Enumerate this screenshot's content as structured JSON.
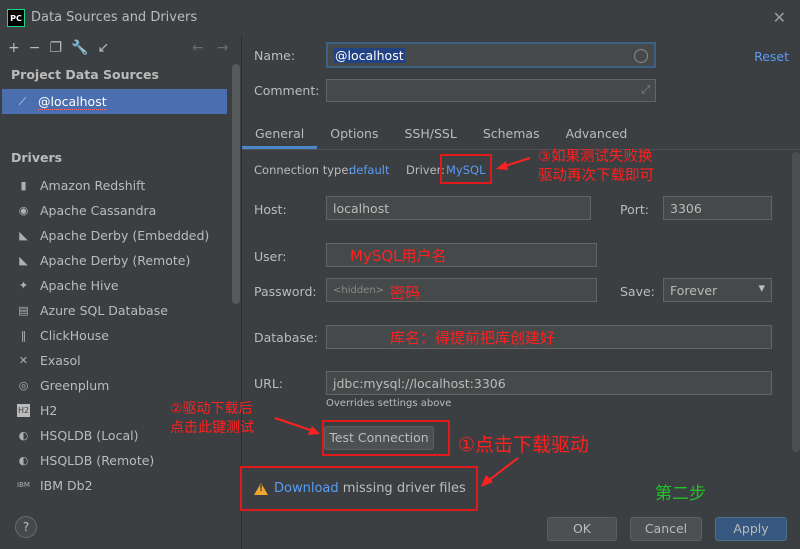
{
  "window": {
    "title": "Data Sources and Drivers",
    "app_badge": "PC",
    "close_glyph": "✕"
  },
  "toolbar": {
    "icons": [
      "add-icon",
      "remove-icon",
      "duplicate-icon",
      "wrench-icon",
      "import-icon",
      "back-arrow-icon",
      "forward-arrow-icon"
    ]
  },
  "left": {
    "project_title": "Project Data Sources",
    "selected": "@localhost",
    "drivers_title": "Drivers",
    "drivers": [
      "Amazon Redshift",
      "Apache Cassandra",
      "Apache Derby (Embedded)",
      "Apache Derby (Remote)",
      "Apache Hive",
      "Azure SQL Database",
      "ClickHouse",
      "Exasol",
      "Greenplum",
      "H2",
      "HSQLDB (Local)",
      "HSQLDB (Remote)",
      "IBM Db2"
    ]
  },
  "form": {
    "name_label": "Name:",
    "name_value": "@localhost",
    "comment_label": "Comment:",
    "reset_label": "Reset",
    "tabs": [
      "General",
      "Options",
      "SSH/SSL",
      "Schemas",
      "Advanced"
    ],
    "conn_type_label": "Connection type:",
    "conn_type_value": "default",
    "driver_label": "Driver:",
    "driver_value": "MySQL",
    "host_label": "Host:",
    "host_value": "localhost",
    "port_label": "Port:",
    "port_value": "3306",
    "user_label": "User:",
    "password_label": "Password:",
    "password_placeholder": "<hidden>",
    "save_label": "Save:",
    "save_value": "Forever",
    "database_label": "Database:",
    "url_label": "URL:",
    "url_value": "jdbc:mysql://localhost:3306",
    "overrides_hint": "Overrides settings above",
    "test_button": "Test Connection"
  },
  "warning": {
    "link": "Download",
    "text": " missing driver files"
  },
  "footer": {
    "help": "?",
    "ok": "OK",
    "cancel": "Cancel",
    "apply": "Apply"
  },
  "annotations": {
    "step3_line1": "③如果测试失败换",
    "step3_line2": "驱动再次下载即可",
    "user_note": "MySQL用户名",
    "password_note": "密码",
    "database_note": "库名：得提前把库创建好",
    "step2_line1": "②驱动下载后",
    "step2_line2": "点击此键测试",
    "step1": "①点击下载驱动",
    "second_step": "第二步"
  },
  "colors": {
    "accent": "#4b6eaf",
    "link": "#589df6",
    "annotation_red": "#ff2020",
    "annotation_green": "#22c22a"
  }
}
